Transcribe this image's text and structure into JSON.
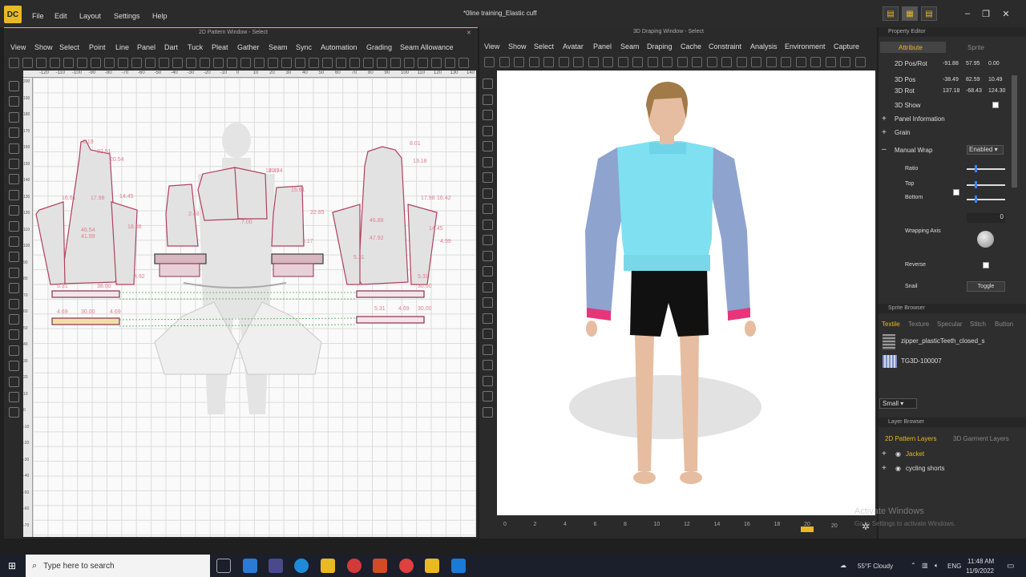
{
  "app": {
    "logo": "DC",
    "title": "*0line training_Elastic cuff"
  },
  "menubar": [
    "File",
    "Edit",
    "Layout",
    "Settings",
    "Help"
  ],
  "pattern_window": {
    "title": "2D Pattern Window - Select",
    "menu": [
      "View",
      "Show",
      "Select",
      "Point",
      "Line",
      "Panel",
      "Dart",
      "Tuck",
      "Pleat",
      "Gather",
      "Seam",
      "Sync",
      "Automation",
      "Grading",
      "Seam Allowance"
    ],
    "ruler_top": [
      "-120",
      "-110",
      "-100",
      "-90",
      "-80",
      "-70",
      "-60",
      "-50",
      "-40",
      "-30",
      "-20",
      "-10",
      "0",
      "10",
      "20",
      "30",
      "40",
      "50",
      "60",
      "70",
      "80",
      "90",
      "100",
      "110",
      "120",
      "130",
      "140"
    ],
    "ruler_left": [
      "200",
      "190",
      "180",
      "170",
      "160",
      "150",
      "140",
      "130",
      "120",
      "110",
      "100",
      "90",
      "80",
      "70",
      "60",
      "50",
      "40",
      "30",
      "20",
      "10",
      "0",
      "-10",
      "-20",
      "-30",
      "-40",
      "-50",
      "-60",
      "-70"
    ],
    "measurements": [
      "8.19",
      "22.51",
      "20.54",
      "14.45",
      "16.61",
      "17.98",
      "46.54",
      "18.66",
      "41.99",
      "4.92",
      "14.45",
      "20.74",
      "15.61",
      "22.85",
      "2.48",
      "7.00",
      "3.17",
      "8.01",
      "13.18",
      "17.98",
      "16.42",
      "46.88",
      "47.92",
      "14.45",
      "5.31",
      "5.31",
      "38.00",
      "4.69",
      "30.00",
      "4.69",
      "30.00",
      "5.31",
      "4.69",
      "30.00",
      "5.31",
      "4.99"
    ]
  },
  "draping_window": {
    "title": "3D Draping Window - Select",
    "menu": [
      "View",
      "Show",
      "Select",
      "Avatar",
      "Panel",
      "Seam",
      "Draping",
      "Cache",
      "Constraint",
      "Analysis",
      "Environment",
      "Capture"
    ],
    "timeline": [
      "0",
      "2",
      "4",
      "6",
      "8",
      "10",
      "12",
      "14",
      "16",
      "18",
      "20"
    ],
    "timeline_value": "20"
  },
  "property_editor": {
    "title": "Property Editor",
    "tabs": [
      "Attribute",
      "Sprite"
    ],
    "rows": [
      {
        "label": "2D Pos/Rot",
        "values": [
          "-91.88",
          "57.95",
          "0.00"
        ]
      },
      {
        "label": "3D Pos",
        "values": [
          "-38.49",
          "82.59",
          "10.49"
        ]
      },
      {
        "label": "3D Rot",
        "values": [
          "137.18",
          "-68.43",
          "124.30"
        ]
      }
    ],
    "show_3d": "3D Show",
    "panel_info": "Panel Information",
    "grain": "Grain",
    "manual_wrap": "Manual Wrap",
    "manual_wrap_value": "Enabled",
    "ratio": "Ratio",
    "top": "Top",
    "bottom": "Bottom",
    "zero": "0",
    "wrapping_axis": "Wrapping Axis",
    "reverse": "Reverse",
    "snail": "Snail",
    "toggle": "Toggle"
  },
  "sprite_browser": {
    "title": "Sprite Browser",
    "tabs": [
      "Textile",
      "Texture",
      "Specular",
      "Stitch",
      "Button"
    ],
    "items": [
      "zipper_plasticTeeth_closed_s",
      "TG3D-100007"
    ],
    "size": "Small"
  },
  "layer_browser": {
    "title": "Layer Browser",
    "tabs": [
      "2D Pattern Layers",
      "3D Garment Layers"
    ],
    "layers": [
      "Jacket",
      "cycling shorts"
    ]
  },
  "watermark": {
    "line1": "Activate Windows",
    "line2": "Go to Settings to activate Windows."
  },
  "taskbar": {
    "search": "Type here to search",
    "weather": "55°F  Cloudy",
    "lang": "ENG",
    "time": "11:48 AM",
    "date": "11/9/2022"
  },
  "colors": {
    "accent": "#e8b923",
    "jacket_body": "#7ee0f0",
    "sleeves": "#8fa3cf",
    "cuff": "#e8357a",
    "shorts": "#111111"
  }
}
